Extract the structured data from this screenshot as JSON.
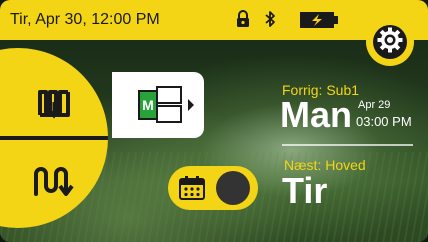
{
  "status_bar": {
    "datetime": "Tir, Apr 30, 12:00 PM",
    "icons": [
      "lock-icon",
      "bluetooth-icon",
      "battery-charging-icon"
    ]
  },
  "settings": {
    "icon": "gear-icon"
  },
  "mode_selector": {
    "top_icon": "manual-mode-icon",
    "bottom_icon": "auto-mode-icon"
  },
  "program": {
    "label": "M",
    "icon": "program-select-icon"
  },
  "schedule_toggle": {
    "icon": "calendar-icon"
  },
  "previous": {
    "label": "Forrig: Sub1",
    "day": "Man",
    "date": "Apr 29",
    "time": "03:00 PM"
  },
  "next": {
    "label": "Næst: Hoved",
    "day": "Tir"
  },
  "colors": {
    "accent": "#f4d516",
    "dark": "#1a1a1a",
    "program_green": "#27a33a"
  }
}
